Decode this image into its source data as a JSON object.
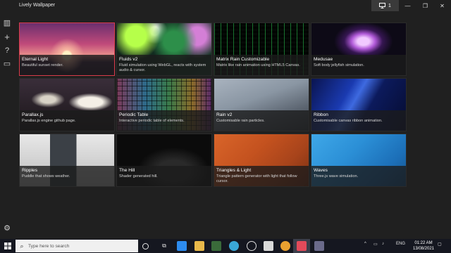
{
  "app": {
    "title": "Lively Wallpaper"
  },
  "titlebar": {
    "screen_count": "1"
  },
  "sidebar": {
    "items": [
      {
        "name": "library-icon",
        "glyph": "▥"
      },
      {
        "name": "add-icon",
        "glyph": "+"
      },
      {
        "name": "help-icon",
        "glyph": "?"
      },
      {
        "name": "chat-icon",
        "glyph": "▭"
      }
    ],
    "settings_glyph": "⚙"
  },
  "wallpapers": [
    {
      "title": "Eternal Light",
      "desc": "Beautiful sunset render."
    },
    {
      "title": "Fluids v2",
      "desc": "Fluid simulation using WebGL, reacts with system audio & cursor."
    },
    {
      "title": "Matrix Rain Customizable",
      "desc": "Matrix like rain animation using HTML5 Canvas."
    },
    {
      "title": "Medusae",
      "desc": "Soft body jellyfish simulation."
    },
    {
      "title": "Parallax.js",
      "desc": "Parallax.js engine github page."
    },
    {
      "title": "Periodic Table",
      "desc": "Interactive periodic table of elements."
    },
    {
      "title": "Rain v2",
      "desc": "Customisable rain particles."
    },
    {
      "title": "Ribbon",
      "desc": "Customisable canvas ribbon animation."
    },
    {
      "title": "Ripples",
      "desc": "Puddle that shows weather."
    },
    {
      "title": "The Hill",
      "desc": "Shader generated hill."
    },
    {
      "title": "Triangles & Light",
      "desc": "Triangle pattern generator with light that follow cursor."
    },
    {
      "title": "Waves",
      "desc": "Three.js wave simulation."
    }
  ],
  "taskbar": {
    "search_placeholder": "Type here to search",
    "language": "ENG",
    "time": "01:22 AM",
    "date": "13/08/2021"
  }
}
